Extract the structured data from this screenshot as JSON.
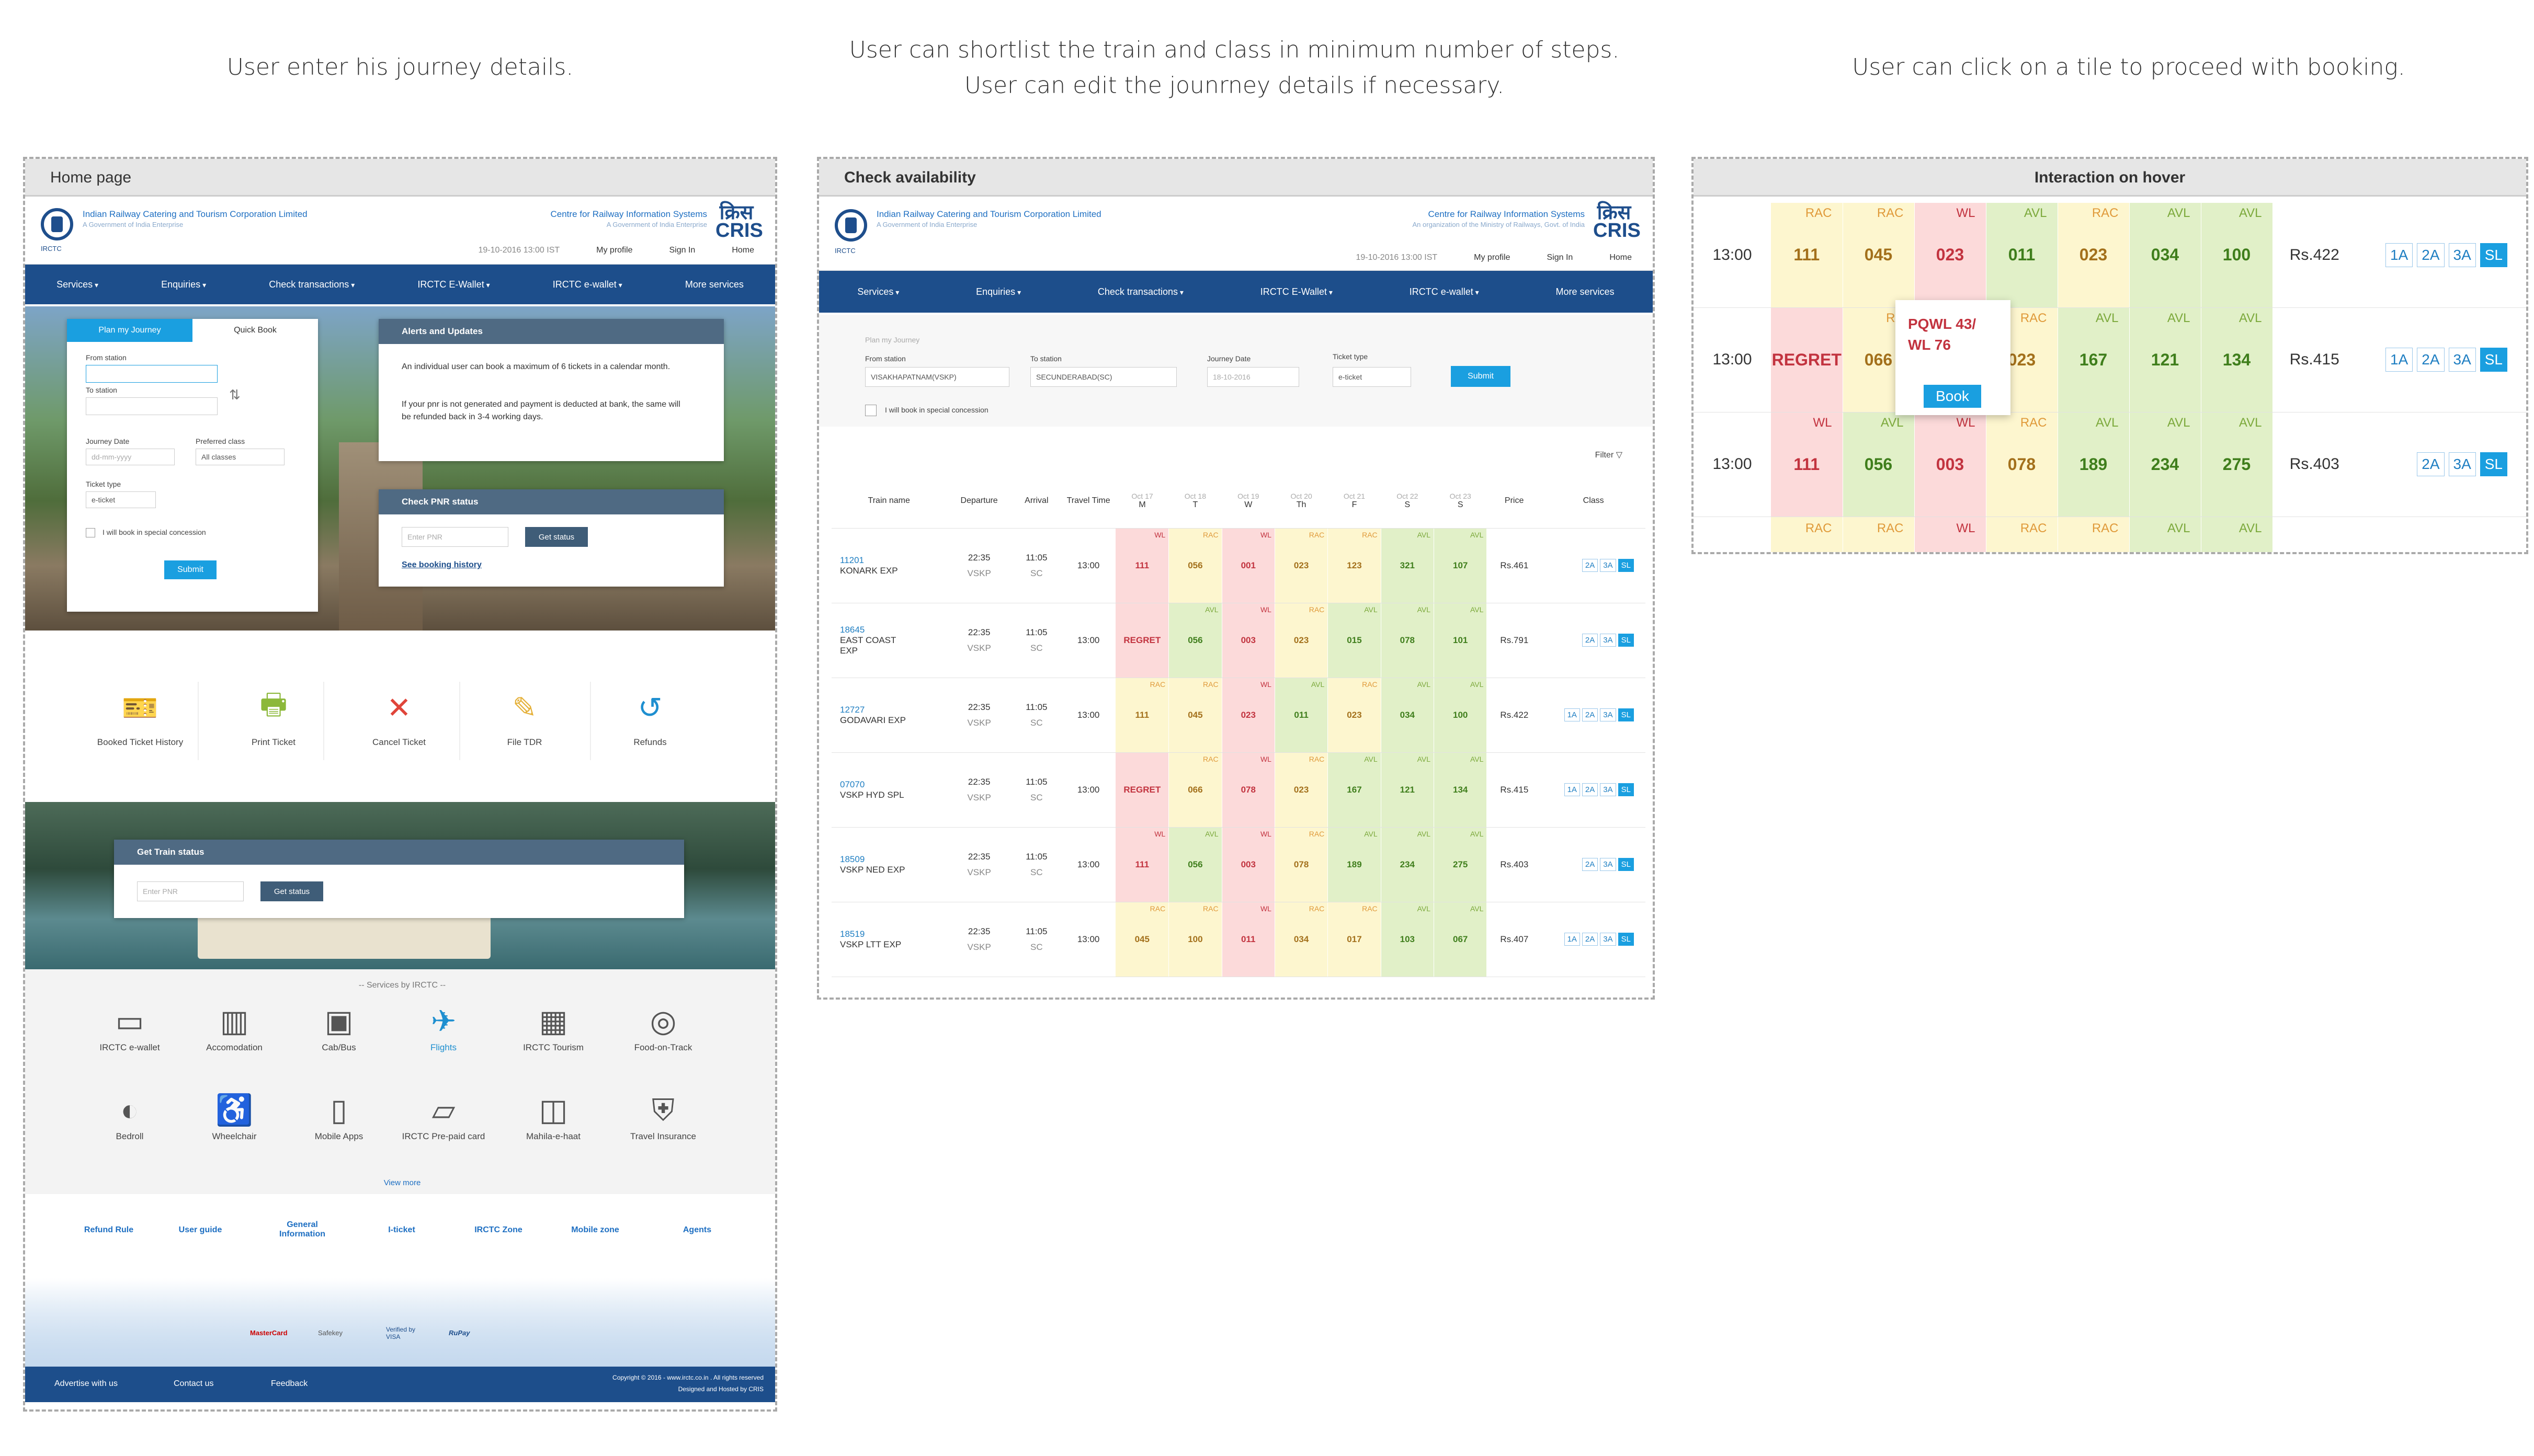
{
  "captions": {
    "c1": "User enter his journey details.",
    "c2_l1": "User can shortlist the train and class in minimum number of steps.",
    "c2_l2": "User can edit the jounrney details if necessary.",
    "c3": "User can click on a tile to proceed with booking."
  },
  "brand": {
    "irctc_logo": "IRCTC",
    "org": "Indian Railway Catering and Tourism Corporation Limited",
    "org_sub": "A Government of India Enterprise",
    "cris": "Centre for Railway Information Systems",
    "cris_sub": "A Government of India Enterprise",
    "cris_sub2": "An organization of the Ministry of Railways, Govt. of India",
    "cris_logo": "क्रिस CRIS",
    "datetime": "19-10-2016 13:00 IST",
    "my_profile": "My profile",
    "sign_in": "Sign In",
    "home": "Home"
  },
  "nav": [
    "Services",
    "Enquiries",
    "Check transactions",
    "IRCTC E-Wallet",
    "IRCTC e-wallet",
    "More services"
  ],
  "home": {
    "title": "Home page",
    "tab_plan": "Plan my Journey",
    "tab_quick": "Quick Book",
    "from_station": "From station",
    "to_station": "To station",
    "journey_date": "Journey Date",
    "date_ph": "dd-mm-yyyy",
    "preferred_class": "Preferred class",
    "all_classes": "All classes",
    "ticket_type": "Ticket type",
    "eticket": "e-ticket",
    "concession": "I will book in special concession",
    "submit": "Submit",
    "alerts_title": "Alerts and Updates",
    "alert1": "An individual user can book a maximum of 6 tickets in a calendar month.",
    "alert2": "If your pnr is not generated and payment is deducted at bank, the same will be refunded back in 3-4 working days.",
    "pnr_title": "Check PNR status",
    "enter_pnr": "Enter PNR",
    "get_status": "Get status",
    "see_history": "See booking history",
    "quick": [
      "Booked Ticket History",
      "Print Ticket",
      "Cancel Ticket",
      "File TDR",
      "Refunds"
    ],
    "train_status_title": "Get Train status",
    "services_title": "-- Services by IRCTC --",
    "services": [
      "IRCTC e-wallet",
      "Accomodation",
      "Cab/Bus",
      "Flights",
      "IRCTC Tourism",
      "Food-on-Track",
      "Bedroll",
      "Wheelchair",
      "Mobile Apps",
      "IRCTC Pre-paid card",
      "Mahila-e-haat",
      "Travel Insurance"
    ],
    "view_more": "View more",
    "footer_links": [
      "Refund Rule",
      "User guide",
      "General Information",
      "I-ticket",
      "IRCTC Zone",
      "Mobile zone",
      "Agents"
    ],
    "payment_logos": [
      "MasterCard",
      "Safekey",
      "Verified by VISA",
      "RuPay"
    ],
    "bottom_links": [
      "Advertise with us",
      "Contact us",
      "Feedback"
    ],
    "copyright": "Copyright © 2016 - www.irctc.co.in . All rights reserved",
    "designed": "Designed and Hosted by CRIS"
  },
  "check": {
    "title": "Check availability",
    "plan": "Plan my Journey",
    "from_label": "From station",
    "from_val": "VISAKHAPATNAM(VSKP)",
    "to_label": "To station",
    "to_val": "SECUNDERABAD(SC)",
    "date_label": "Journey Date",
    "date_val": "18-10-2016",
    "type_label": "Ticket type",
    "type_val": "e-ticket",
    "submit": "Submit",
    "concession": "I will book in special concession",
    "filter": "Filter",
    "headers": {
      "train": "Train name",
      "dep": "Departure",
      "arr": "Arrival",
      "travel": "Travel Time",
      "price": "Price",
      "cls": "Class"
    },
    "days": [
      [
        "Oct 17",
        "M"
      ],
      [
        "Oct 18",
        "T"
      ],
      [
        "Oct 19",
        "W"
      ],
      [
        "Oct 20",
        "Th"
      ],
      [
        "Oct 21",
        "F"
      ],
      [
        "Oct 22",
        "S"
      ],
      [
        "Oct 23",
        "S"
      ]
    ],
    "rows": [
      {
        "num": "11201",
        "name": "KONARK EXP",
        "dep": "22:35",
        "depst": "VSKP",
        "arr": "11:05",
        "arrst": "SC",
        "tt": "13:00",
        "cells": [
          [
            "WL",
            "111"
          ],
          [
            "RAC",
            "056"
          ],
          [
            "WL",
            "001"
          ],
          [
            "RAC",
            "023"
          ],
          [
            "RAC",
            "123"
          ],
          [
            "AVL",
            "321"
          ],
          [
            "AVL",
            "107"
          ]
        ],
        "price": "Rs.461",
        "classes": [
          "2A",
          "3A",
          "SL"
        ]
      },
      {
        "num": "18645",
        "name": "EAST COAST EXP",
        "dep": "22:35",
        "depst": "VSKP",
        "arr": "11:05",
        "arrst": "SC",
        "tt": "13:00",
        "cells": [
          [
            "REG",
            "REGRET"
          ],
          [
            "AVL",
            "056"
          ],
          [
            "WL",
            "003"
          ],
          [
            "RAC",
            "023"
          ],
          [
            "AVL",
            "015"
          ],
          [
            "AVL",
            "078"
          ],
          [
            "AVL",
            "101"
          ]
        ],
        "price": "Rs.791",
        "classes": [
          "2A",
          "3A",
          "SL"
        ]
      },
      {
        "num": "12727",
        "name": "GODAVARI EXP",
        "dep": "22:35",
        "depst": "VSKP",
        "arr": "11:05",
        "arrst": "SC",
        "tt": "13:00",
        "cells": [
          [
            "RAC",
            "111"
          ],
          [
            "RAC",
            "045"
          ],
          [
            "WL",
            "023"
          ],
          [
            "AVL",
            "011"
          ],
          [
            "RAC",
            "023"
          ],
          [
            "AVL",
            "034"
          ],
          [
            "AVL",
            "100"
          ]
        ],
        "price": "Rs.422",
        "classes": [
          "1A",
          "2A",
          "3A",
          "SL"
        ]
      },
      {
        "num": "07070",
        "name": "VSKP HYD SPL",
        "dep": "22:35",
        "depst": "VSKP",
        "arr": "11:05",
        "arrst": "SC",
        "tt": "13:00",
        "cells": [
          [
            "REG",
            "REGRET"
          ],
          [
            "RAC",
            "066"
          ],
          [
            "WL",
            "078"
          ],
          [
            "RAC",
            "023"
          ],
          [
            "AVL",
            "167"
          ],
          [
            "AVL",
            "121"
          ],
          [
            "AVL",
            "134"
          ]
        ],
        "price": "Rs.415",
        "classes": [
          "1A",
          "2A",
          "3A",
          "SL"
        ]
      },
      {
        "num": "18509",
        "name": "VSKP NED EXP",
        "dep": "22:35",
        "depst": "VSKP",
        "arr": "11:05",
        "arrst": "SC",
        "tt": "13:00",
        "cells": [
          [
            "WL",
            "111"
          ],
          [
            "AVL",
            "056"
          ],
          [
            "WL",
            "003"
          ],
          [
            "RAC",
            "078"
          ],
          [
            "AVL",
            "189"
          ],
          [
            "AVL",
            "234"
          ],
          [
            "AVL",
            "275"
          ]
        ],
        "price": "Rs.403",
        "classes": [
          "2A",
          "3A",
          "SL"
        ]
      },
      {
        "num": "18519",
        "name": "VSKP LTT EXP",
        "dep": "22:35",
        "depst": "VSKP",
        "arr": "11:05",
        "arrst": "SC",
        "tt": "13:00",
        "cells": [
          [
            "RAC",
            "045"
          ],
          [
            "RAC",
            "100"
          ],
          [
            "WL",
            "011"
          ],
          [
            "RAC",
            "034"
          ],
          [
            "RAC",
            "017"
          ],
          [
            "AVL",
            "103"
          ],
          [
            "AVL",
            "067"
          ]
        ],
        "price": "Rs.407",
        "classes": [
          "1A",
          "2A",
          "3A",
          "SL"
        ]
      }
    ]
  },
  "hover": {
    "title": "Interaction on hover",
    "rows": [
      {
        "tt": "13:00",
        "cells": [
          [
            "RAC",
            "111"
          ],
          [
            "RAC",
            "045"
          ],
          [
            "WL",
            "023"
          ],
          [
            "AVL",
            "011"
          ],
          [
            "RAC",
            "023"
          ],
          [
            "AVL",
            "034"
          ],
          [
            "AVL",
            "100"
          ]
        ],
        "price": "Rs.422",
        "classes": [
          "1A",
          "2A",
          "3A",
          "SL"
        ]
      },
      {
        "tt": "13:00",
        "cells": [
          [
            "REG",
            "REGRET"
          ],
          [
            "RA",
            "066"
          ],
          [
            "WL",
            "078"
          ],
          [
            "RAC",
            "023"
          ],
          [
            "AVL",
            "167"
          ],
          [
            "AVL",
            "121"
          ],
          [
            "AVL",
            "134"
          ]
        ],
        "price": "Rs.415",
        "classes": [
          "1A",
          "2A",
          "3A",
          "SL"
        ]
      },
      {
        "tt": "13:00",
        "cells": [
          [
            "WL",
            "111"
          ],
          [
            "AVL",
            "056"
          ],
          [
            "WL",
            "003"
          ],
          [
            "RAC",
            "078"
          ],
          [
            "AVL",
            "189"
          ],
          [
            "AVL",
            "234"
          ],
          [
            "AVL",
            "275"
          ]
        ],
        "price": "Rs.403",
        "classes": [
          "2A",
          "3A",
          "SL"
        ]
      },
      {
        "tt": "",
        "cells": [
          [
            "RAC",
            ""
          ],
          [
            "RAC",
            ""
          ],
          [
            "WL",
            ""
          ],
          [
            "RAC",
            ""
          ],
          [
            "RAC",
            ""
          ],
          [
            "AVL",
            ""
          ],
          [
            "AVL",
            ""
          ]
        ],
        "price": "",
        "classes": []
      }
    ],
    "tooltip": "PQWL 43/ WL 76",
    "book": "Book"
  }
}
